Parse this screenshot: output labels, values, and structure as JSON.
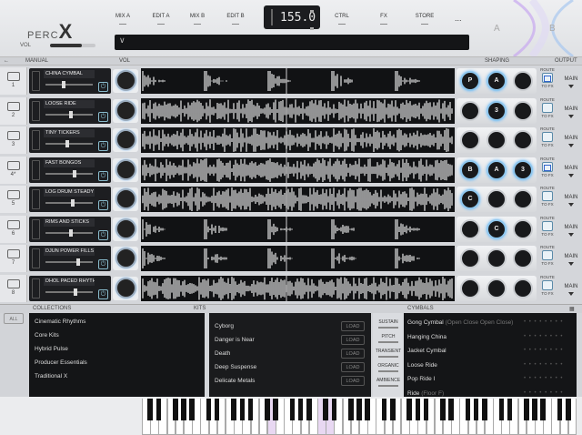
{
  "header": {
    "logo_small": "PERC",
    "logo_big": "X",
    "volume_label": "VOL",
    "menus": [
      "MIX A",
      "EDIT A",
      "MIX B",
      "EDIT B",
      "CTRL",
      "FX",
      "STORE"
    ],
    "tempo": "155.0",
    "more": "...",
    "preset_caret": "∨",
    "ab_a": "A",
    "ab_b": "B"
  },
  "section_bar": {
    "manual": "MANUAL",
    "vol": "VOL",
    "shaping": "SHAPING",
    "output": "OUTPUT"
  },
  "tracks": [
    {
      "num": "1",
      "name": "CHINA CYMBAL",
      "knobs": [
        "P",
        "A",
        ""
      ],
      "on": [
        true,
        true,
        false
      ],
      "route": true,
      "fader": 0.38
    },
    {
      "num": "2",
      "name": "LOOSE RIDE",
      "knobs": [
        "",
        "3",
        ""
      ],
      "on": [
        false,
        true,
        false
      ],
      "route": false,
      "fader": 0.55
    },
    {
      "num": "3",
      "name": "TINY TICKERS",
      "knobs": [
        "",
        "",
        ""
      ],
      "on": [
        false,
        false,
        false
      ],
      "route": false,
      "fader": 0.45
    },
    {
      "num": "4*",
      "name": "FAST BONGOS",
      "knobs": [
        "B",
        "A",
        "3"
      ],
      "on": [
        true,
        true,
        true
      ],
      "route": true,
      "fader": 0.62
    },
    {
      "num": "5",
      "name": "LOG DRUM STEADY",
      "knobs": [
        "C",
        "",
        ""
      ],
      "on": [
        true,
        false,
        false
      ],
      "route": false,
      "fader": 0.58
    },
    {
      "num": "6",
      "name": "RIMS AND STICKS",
      "knobs": [
        "",
        "C",
        ""
      ],
      "on": [
        false,
        true,
        false
      ],
      "route": false,
      "fader": 0.55
    },
    {
      "num": "7",
      "name": "DJUN POWER FILLS",
      "knobs": [
        "",
        "",
        ""
      ],
      "on": [
        false,
        false,
        false
      ],
      "route": false,
      "fader": 0.7
    },
    {
      "num": "8",
      "name": "DHOL PACED RHYTHM",
      "knobs": [
        "",
        "",
        ""
      ],
      "on": [
        false,
        false,
        false
      ],
      "route": false,
      "fader": 0.65
    }
  ],
  "route_label": "ROUTE",
  "tofx_label": "TO FX",
  "output_label": "MAIN",
  "browser": {
    "all": "ALL",
    "collections_title": "COLLECTIONS",
    "kits_title": "KITS",
    "cymbals_title": "CYMBALS",
    "collections": [
      "Cinematic Rhythms",
      "Core Kits",
      "Hybrid Pulse",
      "Producer Essentials",
      "Traditional X"
    ],
    "kits": [
      "Cyborg",
      "Danger is Near",
      "Death",
      "Deep Suspense",
      "Delicate Metals"
    ],
    "load_label": "LOAD",
    "filters": [
      "SUSTAIN",
      "PITCH",
      "TRANSIENT",
      "ORGANIC",
      "AMBIENCE"
    ],
    "cymbals": [
      {
        "name": "Gong Cymbal",
        "detail": "(Open Close Open Close)"
      },
      {
        "name": "Hanging China",
        "detail": ""
      },
      {
        "name": "Jacket Cymbal",
        "detail": ""
      },
      {
        "name": "Loose Ride",
        "detail": ""
      },
      {
        "name": "Pop Ride I",
        "detail": ""
      },
      {
        "name": "Ride",
        "detail": "(Floor F)"
      }
    ],
    "dots": "• • • • • • • •"
  }
}
